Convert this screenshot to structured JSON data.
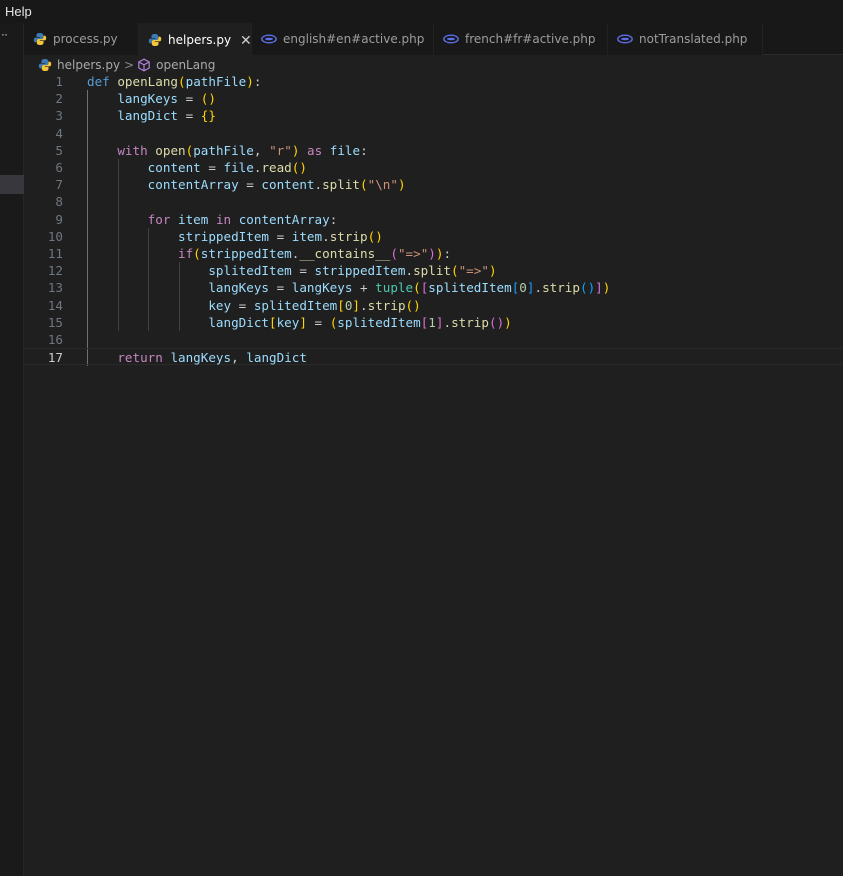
{
  "menu": {
    "help": "Help"
  },
  "activity": {
    "more": "··"
  },
  "tabs": [
    {
      "label": "process.py",
      "icon": "python-file-icon",
      "active": false
    },
    {
      "label": "helpers.py",
      "icon": "python-file-icon",
      "active": true,
      "close": "✕"
    },
    {
      "label": "english#en#active.php",
      "icon": "php-file-icon",
      "active": false
    },
    {
      "label": "french#fr#active.php",
      "icon": "php-file-icon",
      "active": false
    },
    {
      "label": "notTranslated.php",
      "icon": "php-file-icon",
      "active": false
    }
  ],
  "breadcrumb": {
    "file": "helpers.py",
    "separator": ">",
    "symbol": "openLang"
  },
  "colors": {
    "keyword": "#569cd6",
    "control": "#c586c0",
    "function": "#dcdcaa",
    "variable": "#9cdcfe",
    "string": "#ce9178",
    "number": "#b5cea8",
    "class": "#4ec9b0"
  },
  "editor": {
    "current_line": 17,
    "line_numbers": [
      "1",
      "2",
      "3",
      "4",
      "5",
      "6",
      "7",
      "8",
      "9",
      "10",
      "11",
      "12",
      "13",
      "14",
      "15",
      "16",
      "17"
    ],
    "lines": [
      [
        [
          "kw",
          "def"
        ],
        [
          "op",
          " "
        ],
        [
          "fn",
          "openLang"
        ],
        [
          "b1",
          "("
        ],
        [
          "var",
          "pathFile"
        ],
        [
          "b1",
          ")"
        ],
        [
          "op",
          ":"
        ]
      ],
      [
        [
          "op",
          "    "
        ],
        [
          "var",
          "langKeys"
        ],
        [
          "op",
          " = "
        ],
        [
          "b1",
          "()"
        ]
      ],
      [
        [
          "op",
          "    "
        ],
        [
          "var",
          "langDict"
        ],
        [
          "op",
          " = "
        ],
        [
          "b1",
          "{}"
        ]
      ],
      [],
      [
        [
          "op",
          "    "
        ],
        [
          "ctl",
          "with"
        ],
        [
          "op",
          " "
        ],
        [
          "fn",
          "open"
        ],
        [
          "b1",
          "("
        ],
        [
          "var",
          "pathFile"
        ],
        [
          "op",
          ", "
        ],
        [
          "str",
          "\"r\""
        ],
        [
          "b1",
          ")"
        ],
        [
          "op",
          " "
        ],
        [
          "ctl",
          "as"
        ],
        [
          "op",
          " "
        ],
        [
          "var",
          "file"
        ],
        [
          "op",
          ":"
        ]
      ],
      [
        [
          "op",
          "        "
        ],
        [
          "var",
          "content"
        ],
        [
          "op",
          " = "
        ],
        [
          "var",
          "file"
        ],
        [
          "op",
          "."
        ],
        [
          "fn",
          "read"
        ],
        [
          "b1",
          "()"
        ]
      ],
      [
        [
          "op",
          "        "
        ],
        [
          "var",
          "contentArray"
        ],
        [
          "op",
          " = "
        ],
        [
          "var",
          "content"
        ],
        [
          "op",
          "."
        ],
        [
          "fn",
          "split"
        ],
        [
          "b1",
          "("
        ],
        [
          "str",
          "\"\\n\""
        ],
        [
          "b1",
          ")"
        ]
      ],
      [],
      [
        [
          "op",
          "        "
        ],
        [
          "ctl",
          "for"
        ],
        [
          "op",
          " "
        ],
        [
          "var",
          "item"
        ],
        [
          "op",
          " "
        ],
        [
          "ctl",
          "in"
        ],
        [
          "op",
          " "
        ],
        [
          "var",
          "contentArray"
        ],
        [
          "op",
          ":"
        ]
      ],
      [
        [
          "op",
          "            "
        ],
        [
          "var",
          "strippedItem"
        ],
        [
          "op",
          " = "
        ],
        [
          "var",
          "item"
        ],
        [
          "op",
          "."
        ],
        [
          "fn",
          "strip"
        ],
        [
          "b1",
          "()"
        ]
      ],
      [
        [
          "op",
          "            "
        ],
        [
          "ctl",
          "if"
        ],
        [
          "b1",
          "("
        ],
        [
          "var",
          "strippedItem"
        ],
        [
          "op",
          "."
        ],
        [
          "fn",
          "__contains__"
        ],
        [
          "b2",
          "("
        ],
        [
          "str",
          "\"=>\""
        ],
        [
          "b2",
          ")"
        ],
        [
          "b1",
          ")"
        ],
        [
          "op",
          ":"
        ]
      ],
      [
        [
          "op",
          "                "
        ],
        [
          "var",
          "splitedItem"
        ],
        [
          "op",
          " = "
        ],
        [
          "var",
          "strippedItem"
        ],
        [
          "op",
          "."
        ],
        [
          "fn",
          "split"
        ],
        [
          "b1",
          "("
        ],
        [
          "str",
          "\"=>\""
        ],
        [
          "b1",
          ")"
        ]
      ],
      [
        [
          "op",
          "                "
        ],
        [
          "var",
          "langKeys"
        ],
        [
          "op",
          " = "
        ],
        [
          "var",
          "langKeys"
        ],
        [
          "op",
          " + "
        ],
        [
          "cls",
          "tuple"
        ],
        [
          "b1",
          "("
        ],
        [
          "b2",
          "["
        ],
        [
          "var",
          "splitedItem"
        ],
        [
          "b3",
          "["
        ],
        [
          "num",
          "0"
        ],
        [
          "b3",
          "]"
        ],
        [
          "op",
          "."
        ],
        [
          "fn",
          "strip"
        ],
        [
          "b3",
          "()"
        ],
        [
          "b2",
          "]"
        ],
        [
          "b1",
          ")"
        ]
      ],
      [
        [
          "op",
          "                "
        ],
        [
          "var",
          "key"
        ],
        [
          "op",
          " = "
        ],
        [
          "var",
          "splitedItem"
        ],
        [
          "b1",
          "["
        ],
        [
          "num",
          "0"
        ],
        [
          "b1",
          "]"
        ],
        [
          "op",
          "."
        ],
        [
          "fn",
          "strip"
        ],
        [
          "b1",
          "()"
        ]
      ],
      [
        [
          "op",
          "                "
        ],
        [
          "var",
          "langDict"
        ],
        [
          "b1",
          "["
        ],
        [
          "var",
          "key"
        ],
        [
          "b1",
          "]"
        ],
        [
          "op",
          " = "
        ],
        [
          "b1",
          "("
        ],
        [
          "var",
          "splitedItem"
        ],
        [
          "b2",
          "["
        ],
        [
          "num",
          "1"
        ],
        [
          "b2",
          "]"
        ],
        [
          "op",
          "."
        ],
        [
          "fn",
          "strip"
        ],
        [
          "b2",
          "()"
        ],
        [
          "b1",
          ")"
        ]
      ],
      [],
      [
        [
          "op",
          "    "
        ],
        [
          "ctl",
          "return"
        ],
        [
          "op",
          " "
        ],
        [
          "var",
          "langKeys"
        ],
        [
          "op",
          ", "
        ],
        [
          "var",
          "langDict"
        ]
      ]
    ]
  }
}
